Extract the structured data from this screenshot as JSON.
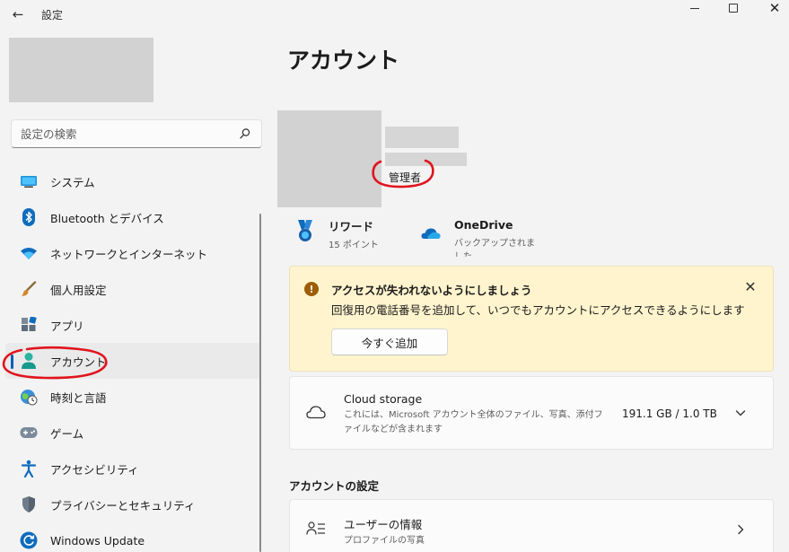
{
  "titlebar": {
    "app_title": "設定"
  },
  "search": {
    "placeholder": "設定の検索"
  },
  "nav": {
    "items": [
      {
        "label": "システム"
      },
      {
        "label": "Bluetooth とデバイス"
      },
      {
        "label": "ネットワークとインターネット"
      },
      {
        "label": "個人用設定"
      },
      {
        "label": "アプリ"
      },
      {
        "label": "アカウント",
        "selected": true
      },
      {
        "label": "時刻と言語"
      },
      {
        "label": "ゲーム"
      },
      {
        "label": "アクセシビリティ"
      },
      {
        "label": "プライバシーとセキュリティ"
      },
      {
        "label": "Windows Update"
      }
    ]
  },
  "main": {
    "title": "アカウント",
    "role": "管理者",
    "rewards": {
      "title": "リワード",
      "points": "15 ポイント"
    },
    "onedrive": {
      "title": "OneDrive",
      "status": "バックアップされました"
    },
    "banner": {
      "title": "アクセスが失われないようにしましょう",
      "message": "回復用の電話番号を追加して、いつでもアカウントにアクセスできるようにします",
      "button": "今すぐ追加"
    },
    "cloud_storage": {
      "title": "Cloud storage",
      "description": "これには、Microsoft アカウント全体のファイル、写真、添付ファイルなどが含まれます",
      "usage": "191.1 GB / 1.0 TB"
    },
    "account_settings": {
      "section_title": "アカウントの設定",
      "user_info": {
        "title": "ユーザーの情報",
        "subtitle": "プロファイルの写真"
      }
    }
  },
  "colors": {
    "accent": "#005fb8",
    "banner_bg": "#fff4ce",
    "warning": "#9d5d00",
    "annotation": "#e0141e"
  }
}
